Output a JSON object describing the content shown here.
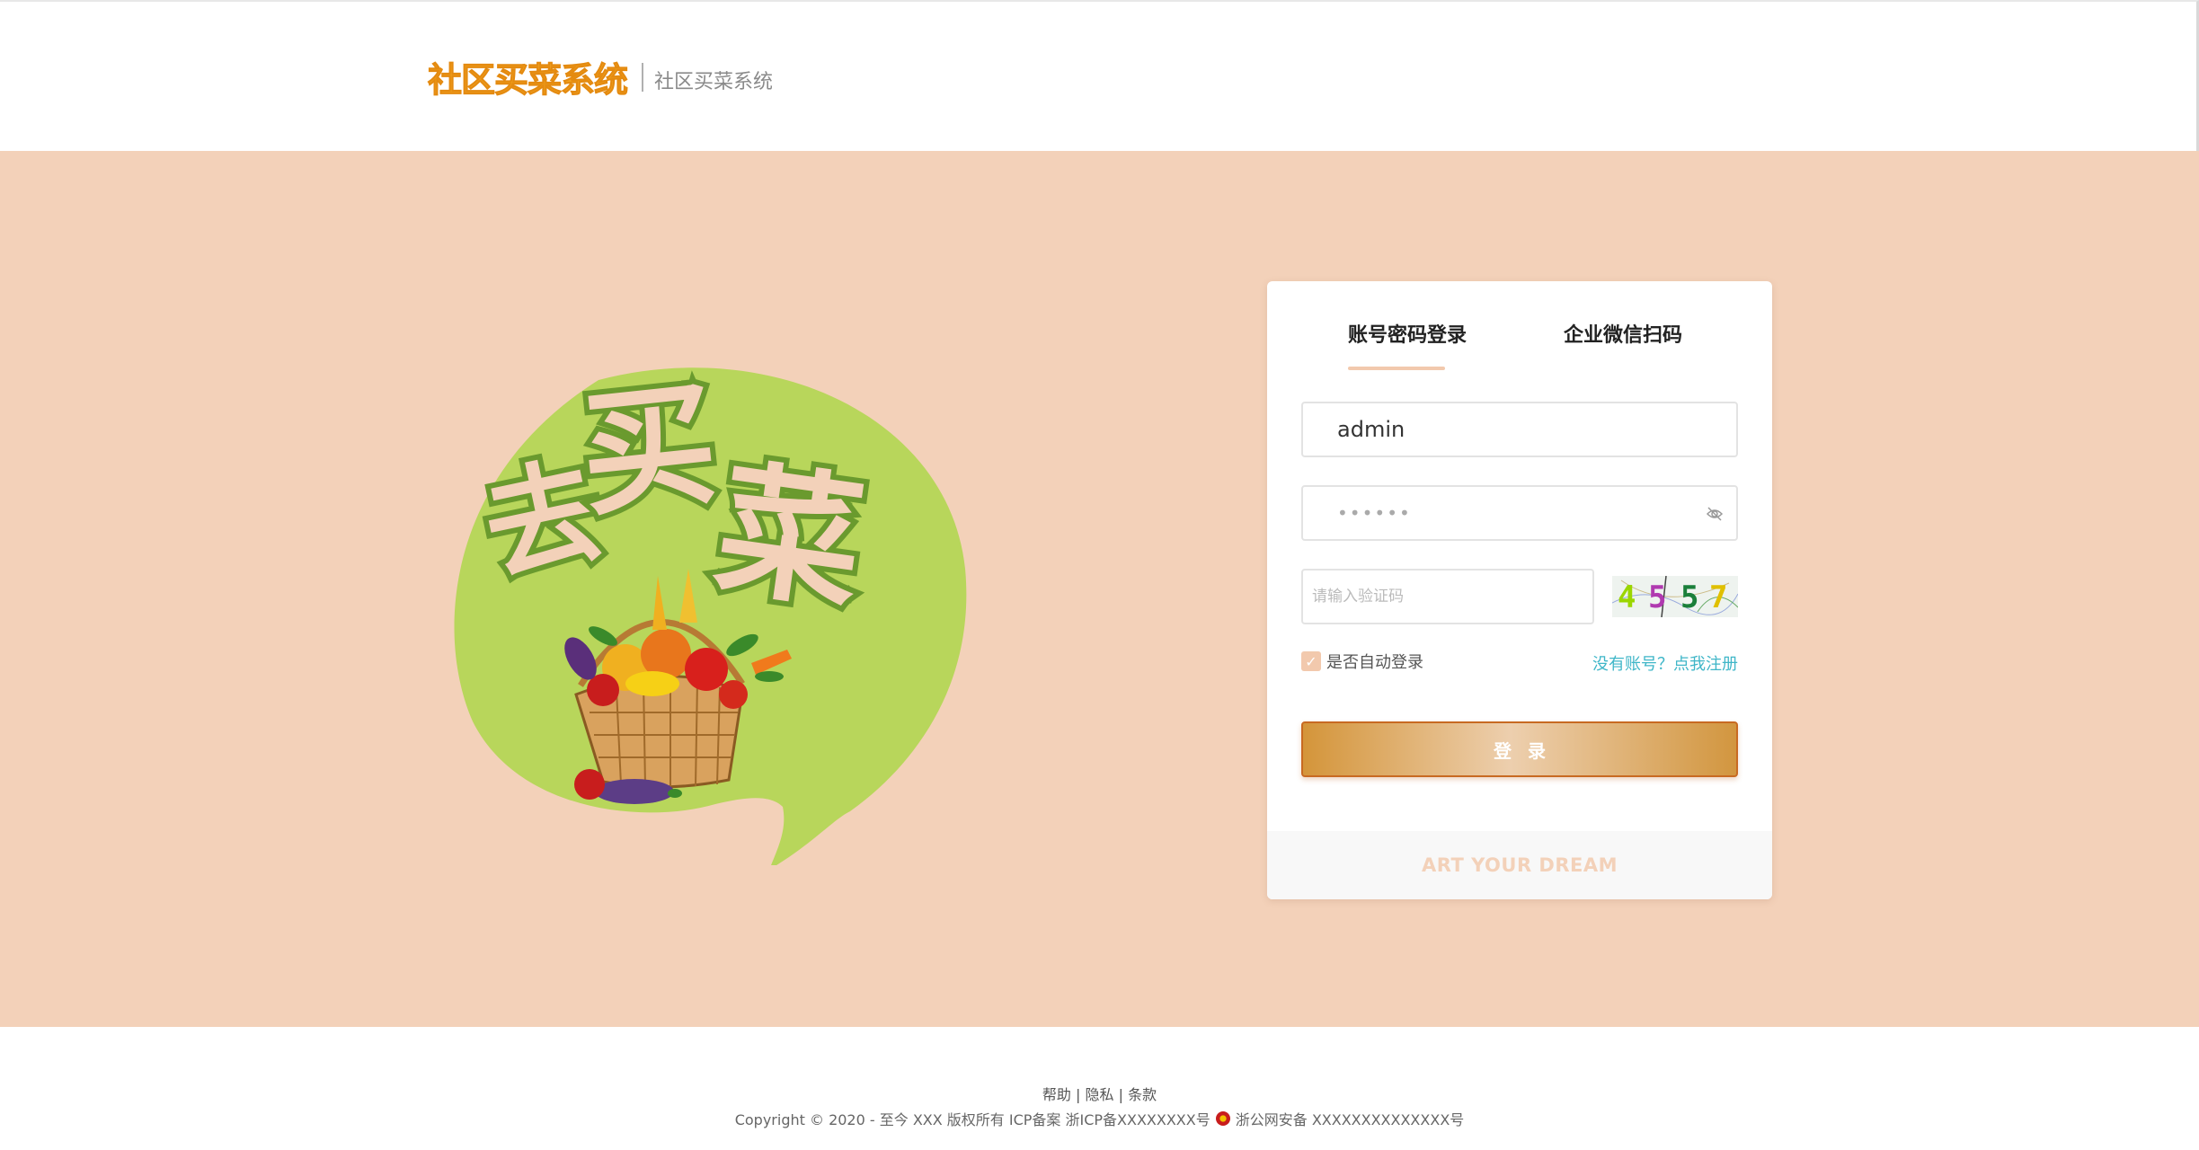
{
  "header": {
    "logo_text": "社区买菜系统",
    "subtitle": "社区买菜系统"
  },
  "illustration": {
    "title_chars": "去买菜",
    "icon": "vegetable-basket-icon",
    "bubble_color": "#b8d65b"
  },
  "login": {
    "tabs": [
      {
        "label": "账号密码登录",
        "active": true
      },
      {
        "label": "企业微信扫码",
        "active": false
      }
    ],
    "username_value": "admin",
    "password_value": "••••••",
    "captcha_placeholder": "请输入验证码",
    "captcha_chars": [
      "4",
      "5",
      "5",
      "7"
    ],
    "captcha_colors": [
      "#9bd600",
      "#b03ab0",
      "#1a7f3a",
      "#e0c000"
    ],
    "remember_label": "是否自动登录",
    "remember_checked": true,
    "register_link": "没有账号？点我注册",
    "login_button": "登录",
    "footer_text": "ART YOUR DREAM"
  },
  "colors": {
    "background": "#f3d1b9",
    "accent": "#d4953a",
    "link": "#3fb6c8",
    "brand": "#f0a21f"
  },
  "footer": {
    "links": [
      "帮助",
      "隐私",
      "条款"
    ],
    "separator": "|",
    "copyright": "Copyright © 2020 - 至今 XXX 版权所有 ICP备案 浙ICP备XXXXXXXX号",
    "police_record": "浙公网安备 XXXXXXXXXXXXXX号"
  }
}
